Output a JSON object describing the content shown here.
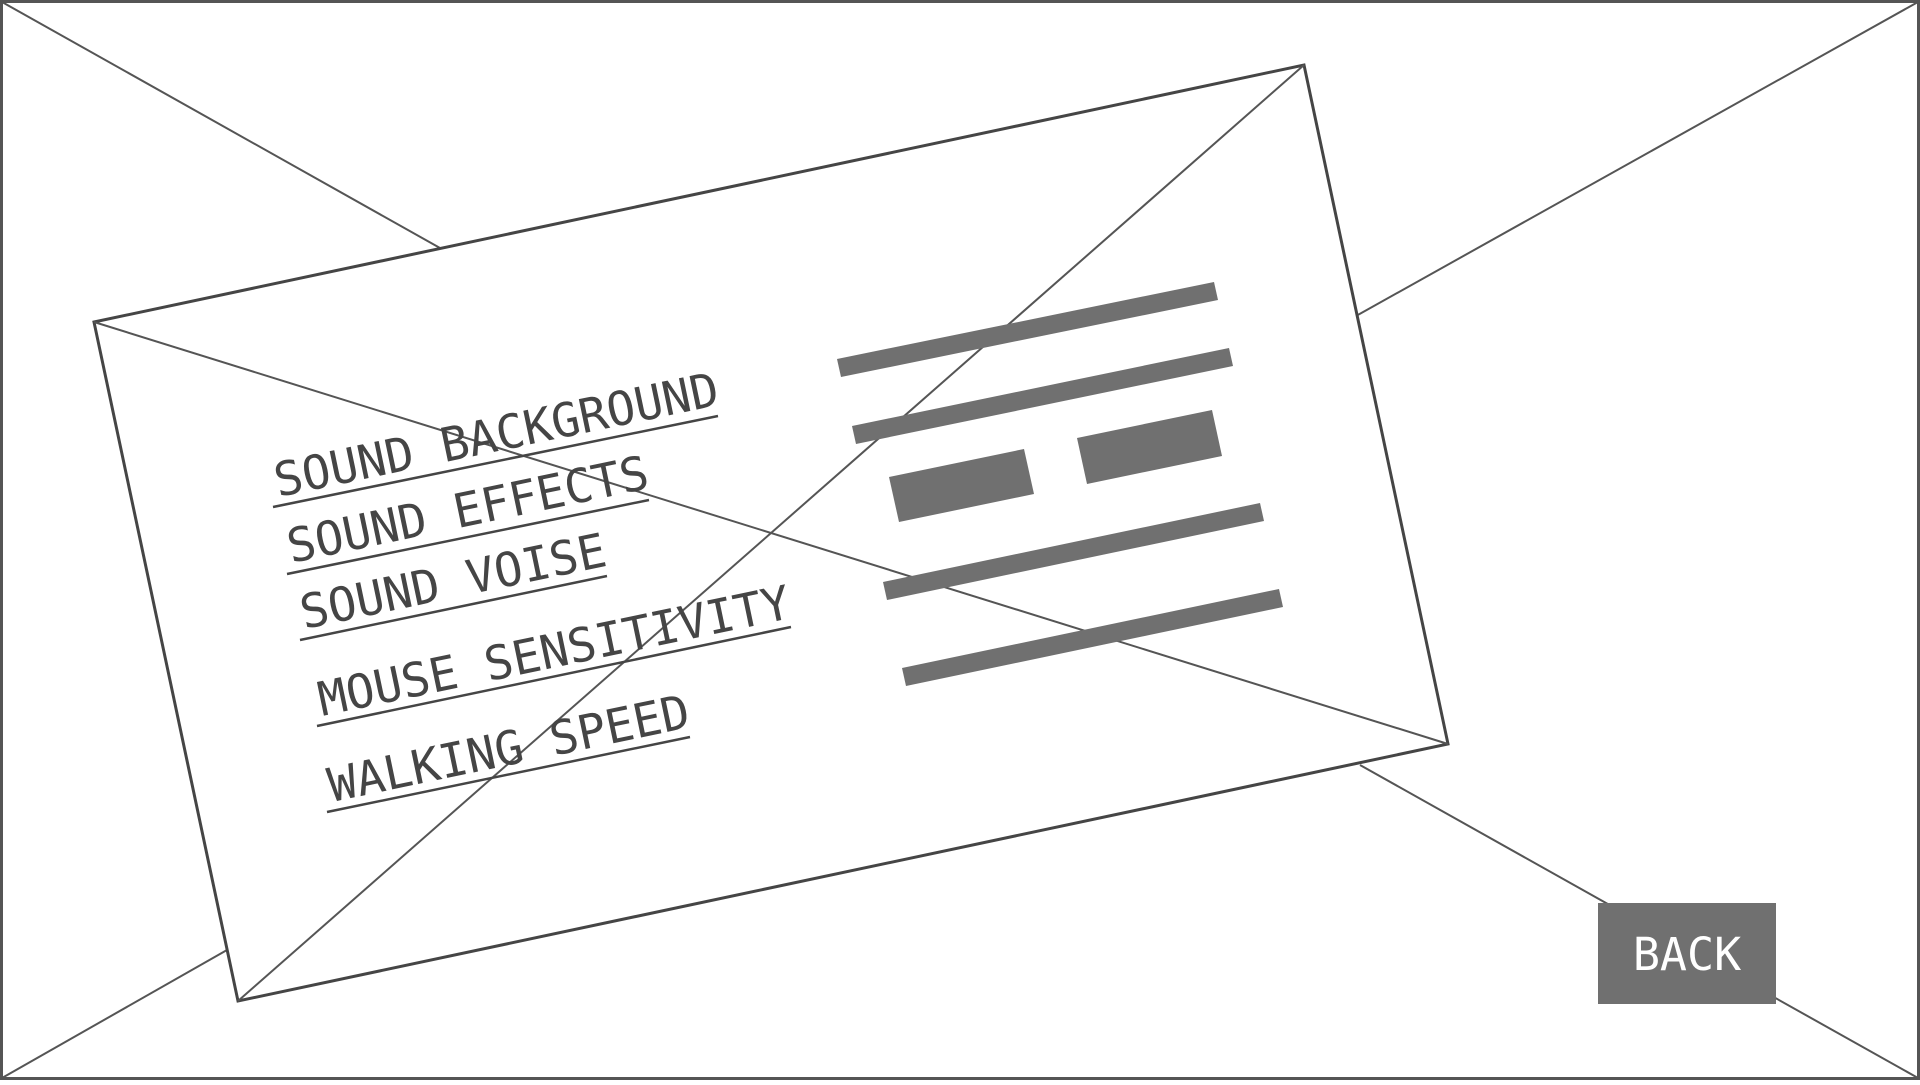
{
  "settings_menu": {
    "items": [
      {
        "id": "sound-background",
        "label": "SOUND BACKGROUND"
      },
      {
        "id": "sound-effects",
        "label": "SOUND EFFECTS"
      },
      {
        "id": "sound-voise",
        "label": "SOUND VOISE"
      },
      {
        "id": "mouse-sensitivity",
        "label": "MOUSE SENSITIVITY"
      },
      {
        "id": "walking-speed",
        "label": "WALKING SPEED"
      }
    ]
  },
  "back_button": {
    "label": "BACK"
  },
  "colors": {
    "wireframe_line": "#555555",
    "text": "#454545",
    "control_fill": "#707070",
    "button_fill": "#707070",
    "button_text": "#ffffff",
    "background": "#ffffff"
  }
}
